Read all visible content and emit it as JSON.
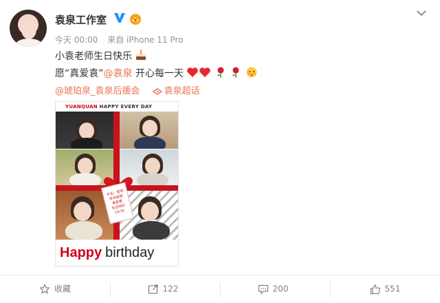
{
  "post": {
    "author": {
      "name": "袁泉工作室",
      "verified_icon": "verified-v-icon",
      "badge_icon": "crown-badge-icon"
    },
    "meta": {
      "time": "今天 00:00",
      "source": "来自 iPhone 11 Pro"
    },
    "text": {
      "line1": "小袁老师生日快乐",
      "line2_prefix": "愿“真爱袁”",
      "line2_mention": "@袁泉",
      "line2_suffix": " 开心每一天",
      "mention_fan": "@琥珀泉_袁泉后援会",
      "topic": "袁泉超话"
    },
    "image": {
      "header_brand": "YUANQUAN",
      "header_text": "HAPPY EVERY DAY",
      "footer_happy": "Happy",
      "footer_birthday": "birthday",
      "tag_lines": [
        "冬至、苍穹",
        "年华绽放",
        "真爱袁",
        "生日快乐",
        "10/16"
      ]
    }
  },
  "actions": {
    "favorite": "收藏",
    "repost_count": "122",
    "comment_count": "200",
    "like_count": "551"
  },
  "colors": {
    "link": "#eb7350",
    "verified": "#1e90ff",
    "ribbon": "#c8121e",
    "happy_text": "#d0021b"
  }
}
